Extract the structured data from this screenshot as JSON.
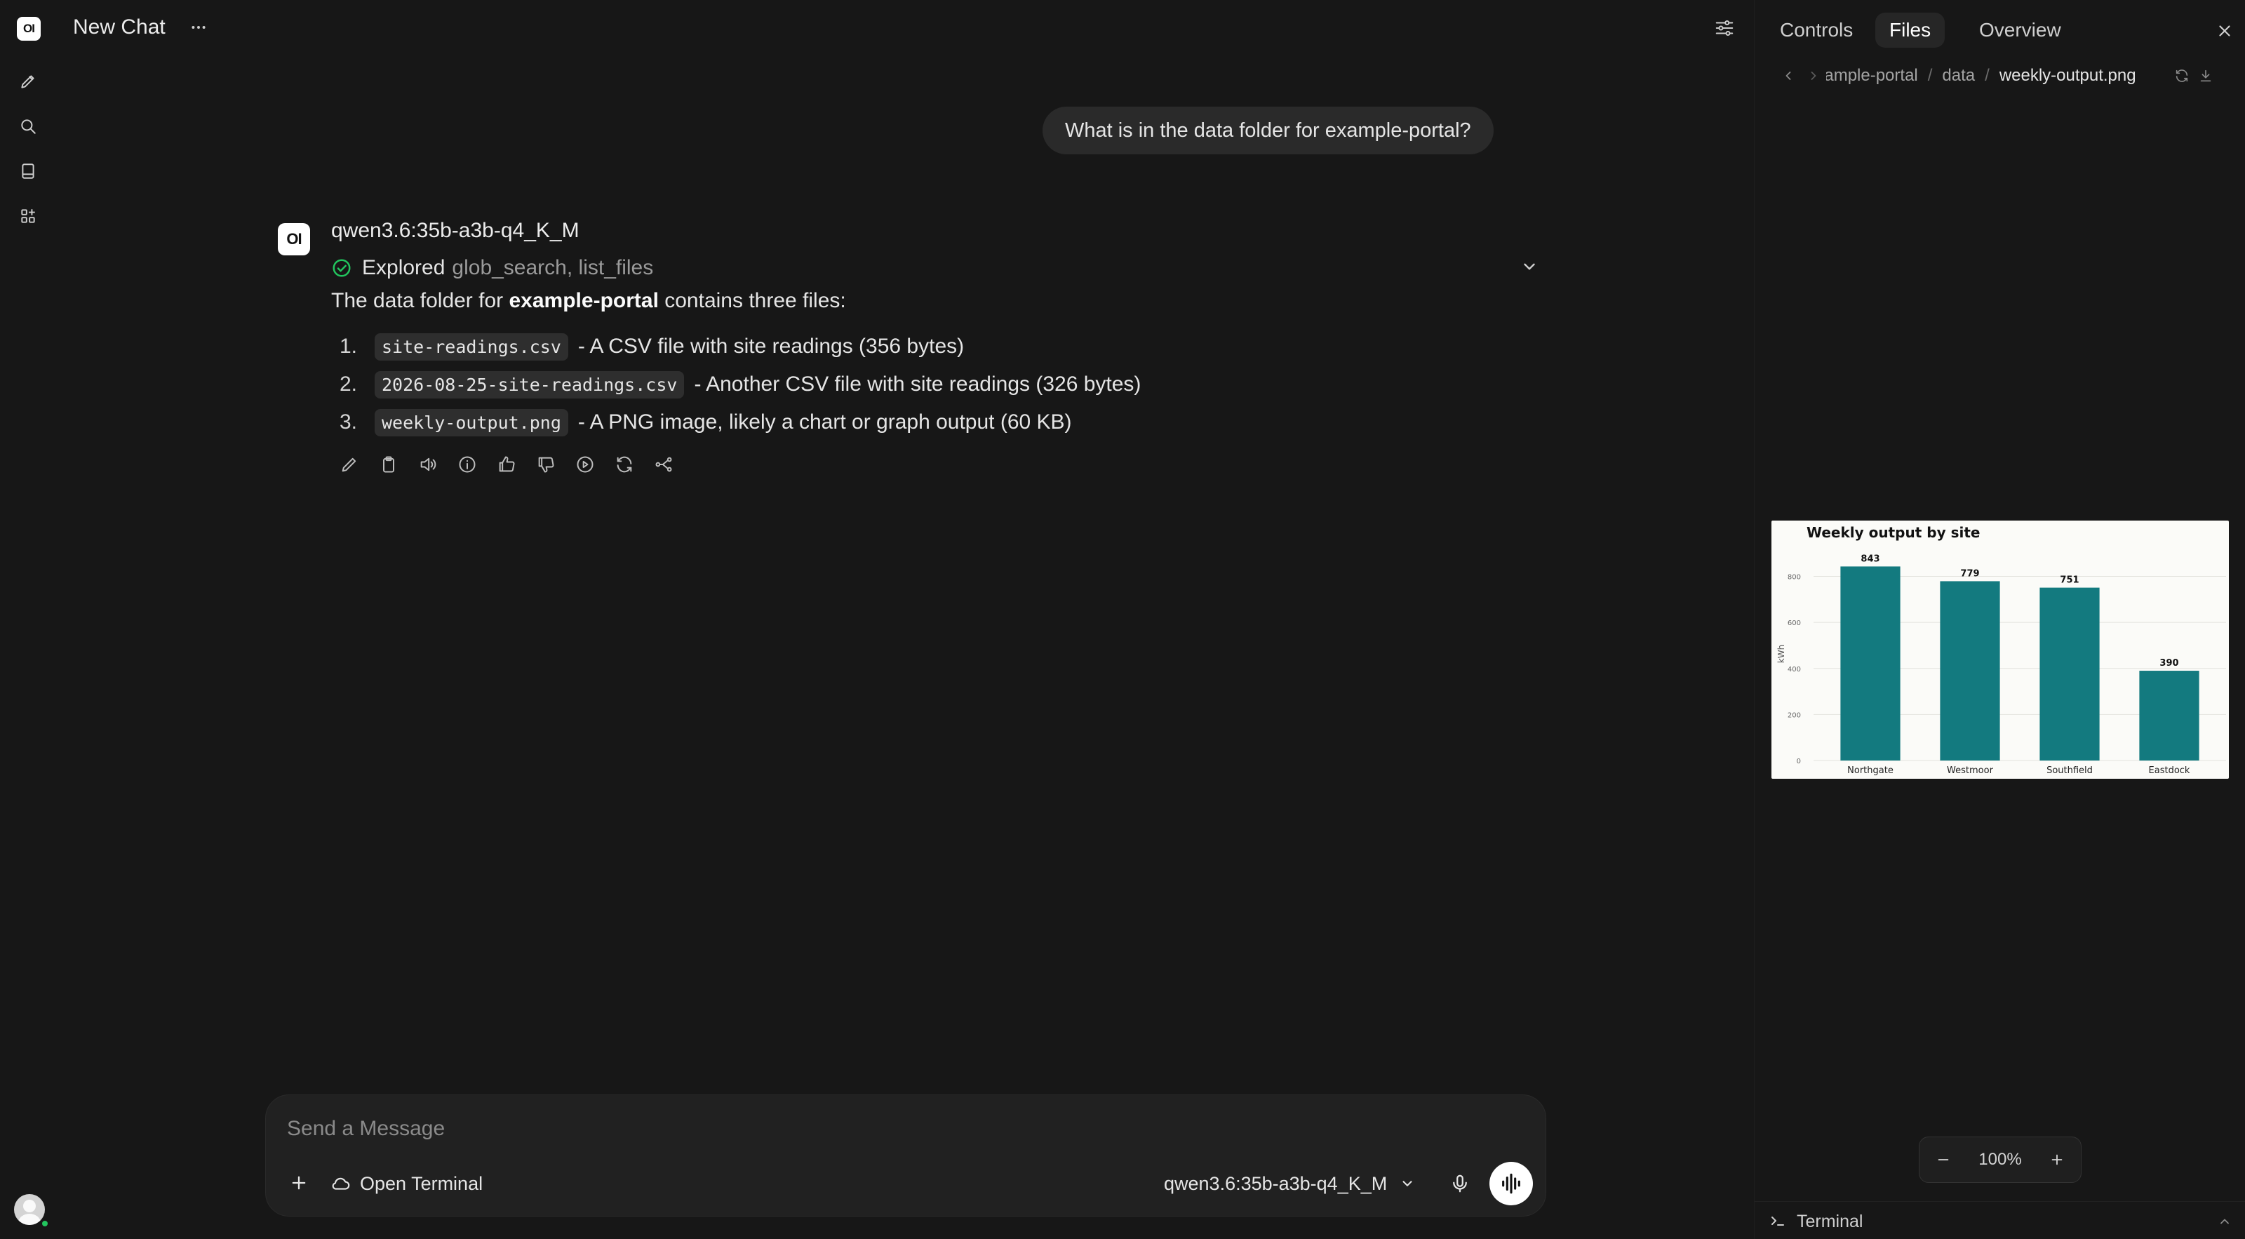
{
  "app": {
    "logo_text": "OI",
    "chat_title": "New Chat"
  },
  "chat": {
    "user_message": "What is in the data folder for example-portal?",
    "assistant": {
      "avatar_text": "OI",
      "model": "qwen3.6:35b-a3b-q4_K_M",
      "explored_label": "Explored",
      "explored_tools": "glob_search, list_files",
      "intro_prefix": "The data folder for",
      "intro_bold": "example-portal",
      "intro_suffix": "contains three files:",
      "files": [
        {
          "num": "1.",
          "name": "site-readings.csv",
          "desc": "- A CSV file with site readings (356 bytes)"
        },
        {
          "num": "2.",
          "name": "2026-08-25-site-readings.csv",
          "desc": "- Another CSV file with site readings (326 bytes)"
        },
        {
          "num": "3.",
          "name": "weekly-output.png",
          "desc": "- A PNG image, likely a chart or graph output (60 KB)"
        }
      ]
    }
  },
  "composer": {
    "placeholder": "Send a Message",
    "open_terminal": "Open Terminal",
    "model": "qwen3.6:35b-a3b-q4_K_M"
  },
  "panel": {
    "tabs": [
      "Controls",
      "Files",
      "Overview"
    ],
    "active_tab": "Files",
    "breadcrumb": [
      "example-portal",
      "data",
      "weekly-output.png"
    ],
    "zoom": "100%",
    "terminal_label": "Terminal"
  },
  "chart_data": {
    "type": "bar",
    "title": "Weekly output by site",
    "ylabel": "kWh",
    "xlabel": "",
    "categories": [
      "Northgate",
      "Westmoor",
      "Southfield",
      "Eastdock"
    ],
    "values": [
      843,
      779,
      751,
      390
    ],
    "yticks": [
      0,
      200,
      400,
      600,
      800
    ],
    "ylim": [
      0,
      890
    ],
    "bar_color": "#137a7f",
    "grid": true
  },
  "colors": {
    "background": "#171717",
    "bubble": "#2a2a2a",
    "success": "#22c55e",
    "chart_bar": "#137a7f"
  }
}
